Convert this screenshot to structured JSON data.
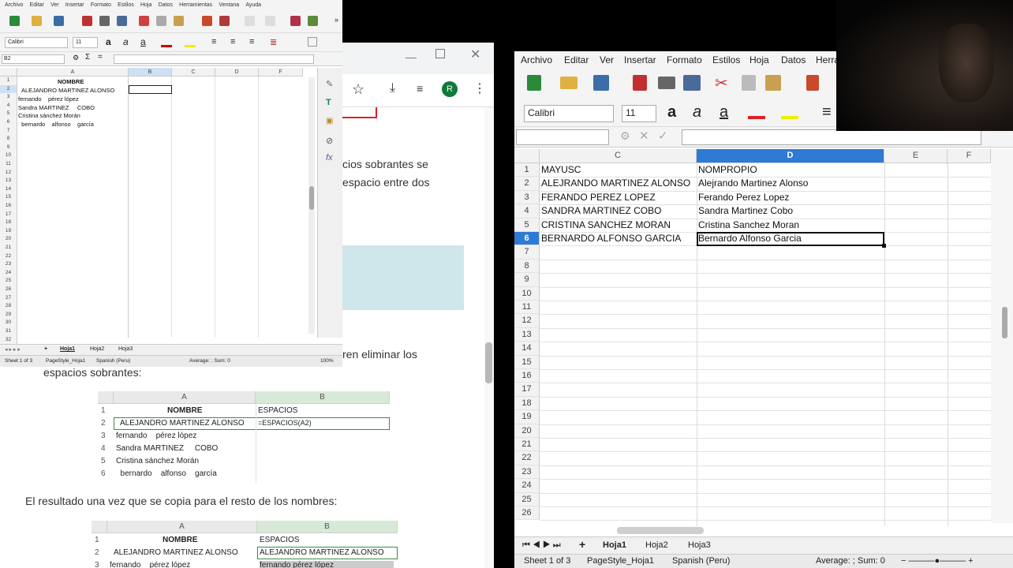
{
  "left_sheet": {
    "menu": [
      "Archivo",
      "Editar",
      "Ver",
      "Insertar",
      "Formato",
      "Estilos",
      "Hoja",
      "Datos",
      "Herramientas",
      "Ventana",
      "Ayuda"
    ],
    "font_name": "Calibri",
    "font_size": "11",
    "name_box": "B2",
    "columns": [
      "A",
      "B",
      "C",
      "D",
      "F"
    ],
    "rows": [
      "1",
      "2",
      "3",
      "4",
      "5",
      "6",
      "7",
      "8",
      "9",
      "10",
      "11",
      "12",
      "13",
      "14",
      "15",
      "16",
      "17",
      "18",
      "19",
      "20",
      "21",
      "22",
      "23",
      "24",
      "25",
      "26",
      "27",
      "28",
      "29",
      "30",
      "31",
      "32"
    ],
    "cells": {
      "a1": "NOMBRE",
      "a2": "ALEJANDRO MARTINEZ ALONSO",
      "a3": "fernando    pérez lópez",
      "a4": "Sandra MARTINEZ     COBO",
      "a5": "Cristina sánchez Morán",
      "a6": "  bernardo    alfonso    garcía"
    },
    "tabs": [
      "Hoja1",
      "Hoja2",
      "Hoja3"
    ],
    "status": {
      "sheet": "Sheet 1 of 3",
      "style": "PageStyle_Hoja1",
      "lang": "Spanish (Peru)",
      "sum": "Average: ; Sum: 0",
      "zoom": "100%"
    }
  },
  "browser": {
    "avatar_letter": "R",
    "text_fragments": {
      "line1": "cios sobrantes se",
      "line2": "espacio entre dos",
      "line3": "ren eliminar los",
      "line4": "espacios sobrantes:",
      "line5": "El resultado una vez que se copia para el resto de los nombres:"
    },
    "table1": {
      "columns": [
        "A",
        "B"
      ],
      "rows": [
        "1",
        "2",
        "3",
        "4",
        "5",
        "6"
      ],
      "header_a": "NOMBRE",
      "header_b": "ESPACIOS",
      "a2": "ALEJANDRO MARTINEZ ALONSO",
      "b2": "=ESPACIOS(A2)",
      "a3": "fernando    pérez lópez",
      "a4": "Sandra MARTINEZ     COBO",
      "a5": "Cristina sánchez Morán",
      "a6": "  bernardo    alfonso    garcía"
    },
    "table2": {
      "columns": [
        "A",
        "B"
      ],
      "rows": [
        "1",
        "2",
        "3"
      ],
      "header_a": "NOMBRE",
      "header_b": "ESPACIOS",
      "a2": "ALEJANDRO MARTINEZ ALONSO",
      "b2": "ALEJANDRO MARTINEZ ALONSO",
      "a3": "fernando    pérez lópez",
      "b3": "fernando pérez lópez"
    }
  },
  "right_sheet": {
    "menu": [
      "Archivo",
      "Editar",
      "Ver",
      "Insertar",
      "Formato",
      "Estilos",
      "Hoja",
      "Datos",
      "Herra"
    ],
    "font_name": "Calibri",
    "font_size": "11",
    "columns": [
      "C",
      "D",
      "E",
      "F"
    ],
    "rows": [
      "1",
      "2",
      "3",
      "4",
      "5",
      "6",
      "7",
      "8",
      "9",
      "10",
      "11",
      "12",
      "13",
      "14",
      "15",
      "16",
      "17",
      "18",
      "19",
      "20",
      "21",
      "22",
      "23",
      "24",
      "25",
      "26"
    ],
    "col_c": [
      "MAYUSC",
      "ALEJRANDO MARTINEZ ALONSO",
      "FERANDO PEREZ LOPEZ",
      "SANDRA MARTINEZ COBO",
      "CRISTINA SANCHEZ MORAN",
      "BERNARDO ALFONSO GARCIA"
    ],
    "col_d": [
      "NOMPROPIO",
      "Alejrando Martinez Alonso",
      "Ferando Perez Lopez",
      "Sandra Martinez Cobo",
      "Cristina Sanchez Moran",
      "Bernardo Alfonso Garcia"
    ],
    "tabs": [
      "Hoja1",
      "Hoja2",
      "Hoja3"
    ],
    "status": {
      "sheet": "Sheet 1 of 3",
      "style": "PageStyle_Hoja1",
      "lang": "Spanish (Peru)",
      "sum": "Average: ; Sum: 0"
    },
    "accent": "#2e7bd6"
  }
}
